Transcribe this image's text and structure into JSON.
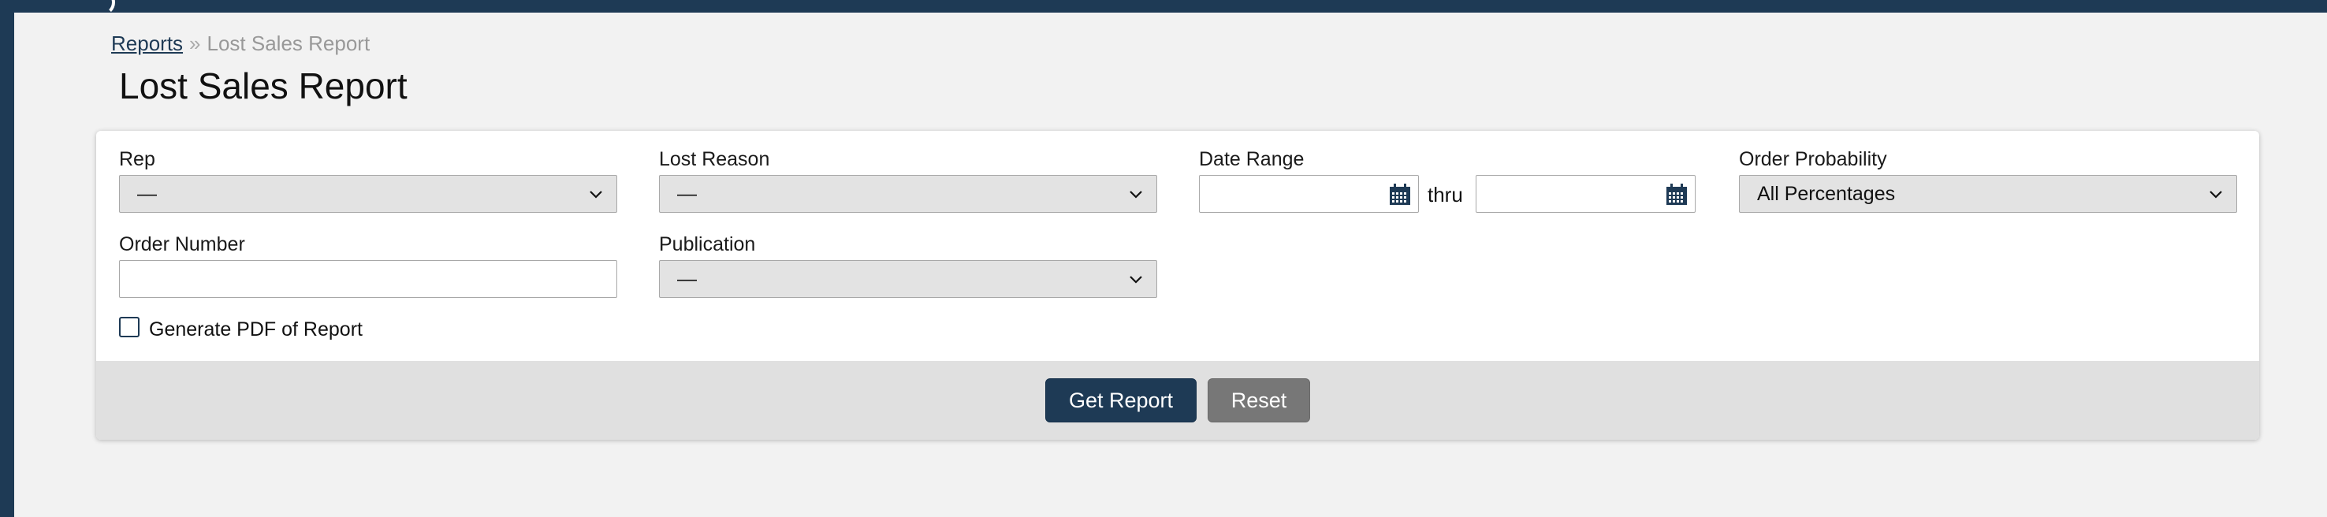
{
  "breadcrumb": {
    "parent": "Reports",
    "separator": "»",
    "current": "Lost Sales Report"
  },
  "page": {
    "title": "Lost Sales Report"
  },
  "form": {
    "rep": {
      "label": "Rep",
      "value": "—"
    },
    "lost_reason": {
      "label": "Lost Reason",
      "value": "—"
    },
    "date_range": {
      "label": "Date Range",
      "from": "",
      "to": "",
      "thru": "thru"
    },
    "order_probability": {
      "label": "Order Probability",
      "value": "All Percentages"
    },
    "order_number": {
      "label": "Order Number",
      "value": ""
    },
    "publication": {
      "label": "Publication",
      "value": "—"
    },
    "generate_pdf": {
      "label": "Generate PDF of Report",
      "checked": false
    }
  },
  "actions": {
    "get_report": "Get Report",
    "reset": "Reset"
  },
  "icons": {
    "chevron": "chevron-down-icon",
    "calendar": "calendar-icon"
  },
  "colors": {
    "primary": "#1e3a55",
    "secondary": "#777777"
  }
}
